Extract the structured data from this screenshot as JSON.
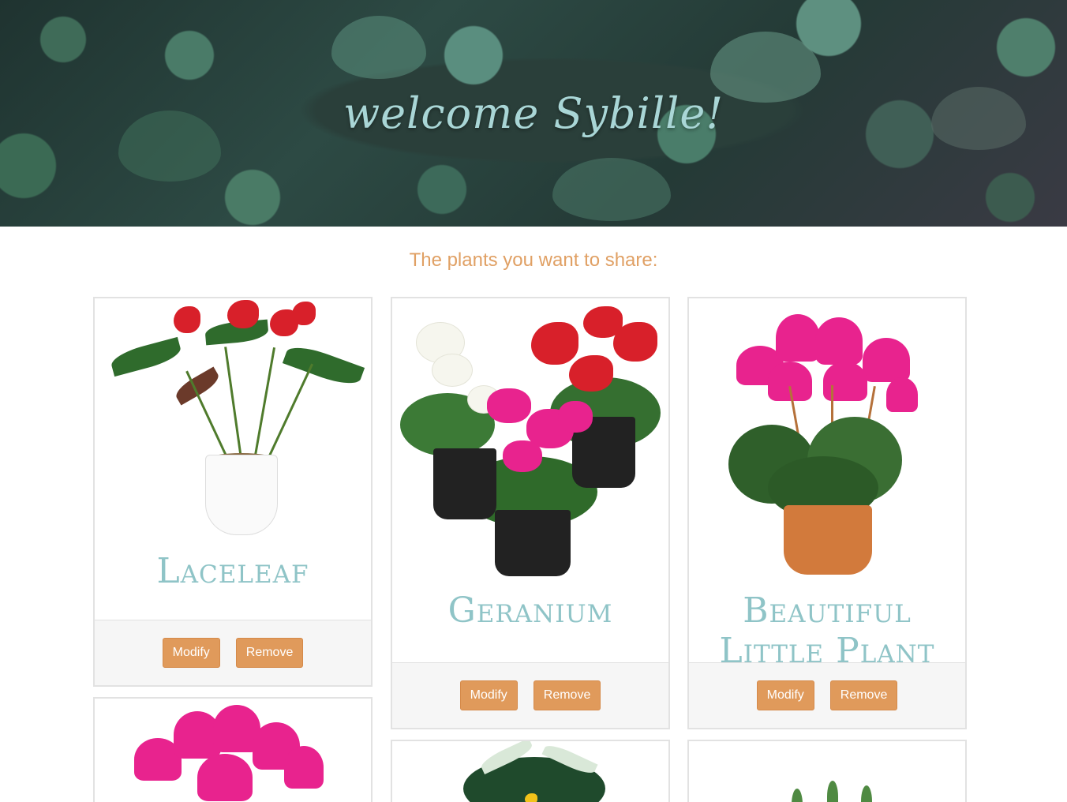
{
  "hero": {
    "title": "welcome Sybille!"
  },
  "subtitle": "The plants you want to share:",
  "cards": [
    {
      "name": "Laceleaf",
      "modify": "Modify",
      "remove": "Remove"
    },
    {
      "name": "Geranium",
      "modify": "Modify",
      "remove": "Remove"
    },
    {
      "name": "Beautiful Little Plant",
      "modify": "Modify",
      "remove": "Remove"
    }
  ],
  "colors": {
    "accent": "#e09a5b",
    "title_teal": "#8fc4c7",
    "subtitle": "#e0a064"
  }
}
